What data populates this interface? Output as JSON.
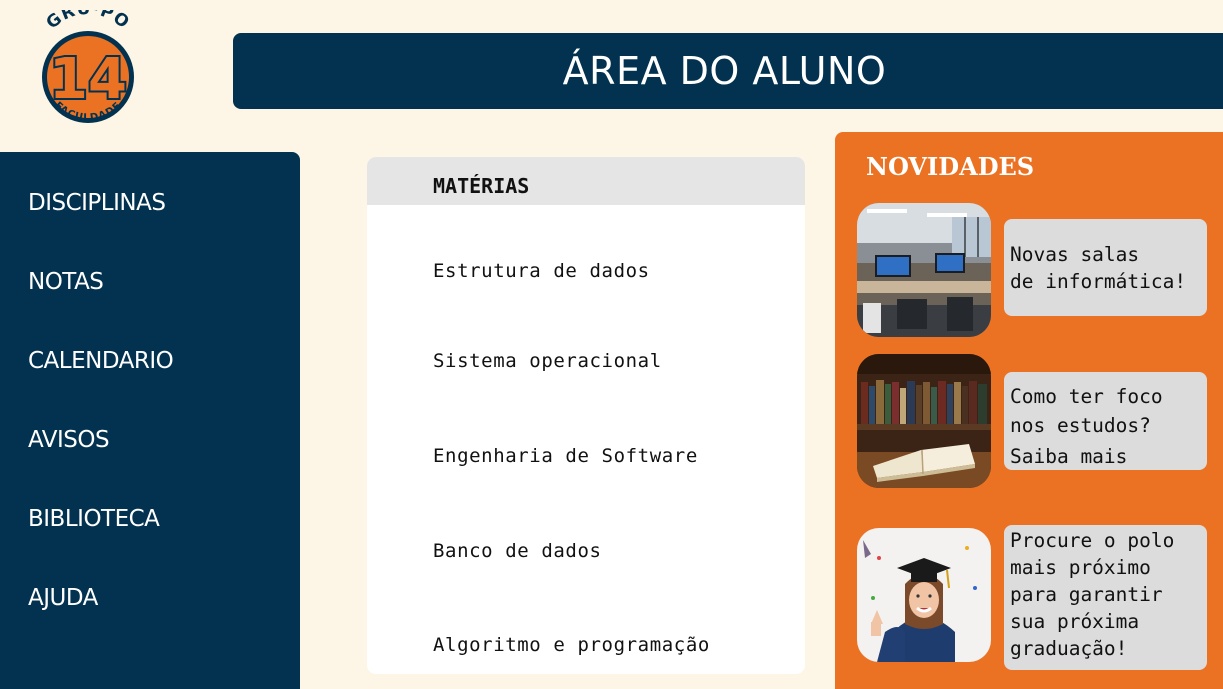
{
  "logo": {
    "top_text": "GRU·PO",
    "number": "14",
    "bottom_text": "FACULDADE"
  },
  "header": {
    "title": "ÁREA DO ALUNO"
  },
  "sidebar": {
    "items": [
      {
        "label": "DISCIPLINAS"
      },
      {
        "label": "NOTAS"
      },
      {
        "label": "CALENDARIO"
      },
      {
        "label": "AVISOS"
      },
      {
        "label": "BIBLIOTECA"
      },
      {
        "label": "AJUDA"
      }
    ]
  },
  "materias": {
    "title": "MATÉRIAS",
    "items": [
      "Estrutura de dados",
      "Sistema operacional",
      "Engenharia de Software",
      "Banco de dados",
      "Algoritmo e programação"
    ]
  },
  "novidades": {
    "title": "NOVIDADES",
    "news": [
      {
        "image": "computer-lab-photo",
        "lines": [
          "Novas salas",
          "de informática!"
        ]
      },
      {
        "image": "open-book-library-photo",
        "lines": [
          "Como ter foco",
          "nos estudos?",
          "Saiba mais"
        ]
      },
      {
        "image": "graduate-student-photo",
        "lines": [
          "Procure o polo",
          "mais próximo",
          "para garantir",
          "sua próxima",
          "graduação!"
        ]
      }
    ]
  },
  "colors": {
    "navy": "#02324f",
    "orange": "#ec7223",
    "cream": "#fdf6e6",
    "card_gray": "#dcdcdc"
  }
}
